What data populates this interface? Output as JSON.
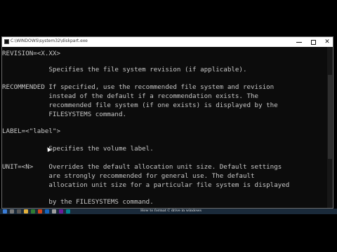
{
  "window": {
    "title": "C:\\WINDOWS\\system32\\diskpart.exe"
  },
  "console_lines": [
    "REVISION=<X.XX>",
    "",
    "            Specifies the file system revision (if applicable).",
    "",
    "RECOMMENDED If specified, use the recommended file system and revision",
    "            instead of the default if a recommendation exists. The",
    "            recommended file system (if one exists) is displayed by the",
    "            FILESYSTEMS command.",
    "",
    "LABEL=<\"label\">",
    "",
    "            Specifies the volume label.",
    "",
    "UNIT=<N>    Overrides the default allocation unit size. Default settings",
    "            are strongly recommended for general use. The default",
    "            allocation unit size for a particular file system is displayed",
    "",
    "            by the FILESYSTEMS command."
  ],
  "taskbar": {
    "caption": "How to format C drive in windows"
  },
  "colors": {
    "console_bg": "#0c0c0c",
    "console_text": "#c8c8c8"
  }
}
